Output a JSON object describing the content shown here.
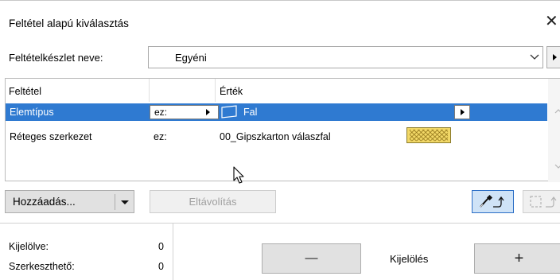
{
  "dialog": {
    "title": "Feltétel alapú kiválasztás",
    "close_glyph": "✕"
  },
  "preset": {
    "label": "Feltételkészlet neve:",
    "value": "Egyéni"
  },
  "table": {
    "headers": [
      "Feltétel",
      "",
      "Érték"
    ],
    "rows": [
      {
        "criterion": "Elemtípus",
        "operator": "ez:",
        "value": "Fal",
        "value_icon": "wall-icon",
        "selected": true
      },
      {
        "criterion": "Réteges szerkezet",
        "operator": "ez:",
        "value": "00_Gipszkarton válaszfal",
        "value_icon": "hatch-swatch",
        "selected": false
      }
    ]
  },
  "buttons": {
    "add": "Hozzáadás...",
    "remove": "Eltávolítás",
    "pick_icon": "eyedropper-icon",
    "marquee_icon": "marquee-icon",
    "minus_glyph": "—",
    "plus_glyph": "+",
    "selection_label": "Kijelölés"
  },
  "stats": {
    "selected_label": "Kijelölve:",
    "selected_value": "0",
    "editable_label": "Szerkeszthető:",
    "editable_value": "0"
  },
  "colors": {
    "selection": "#2f7ad1",
    "accent_border": "#2c6fc6",
    "hatch_fill": "#f2d867"
  }
}
